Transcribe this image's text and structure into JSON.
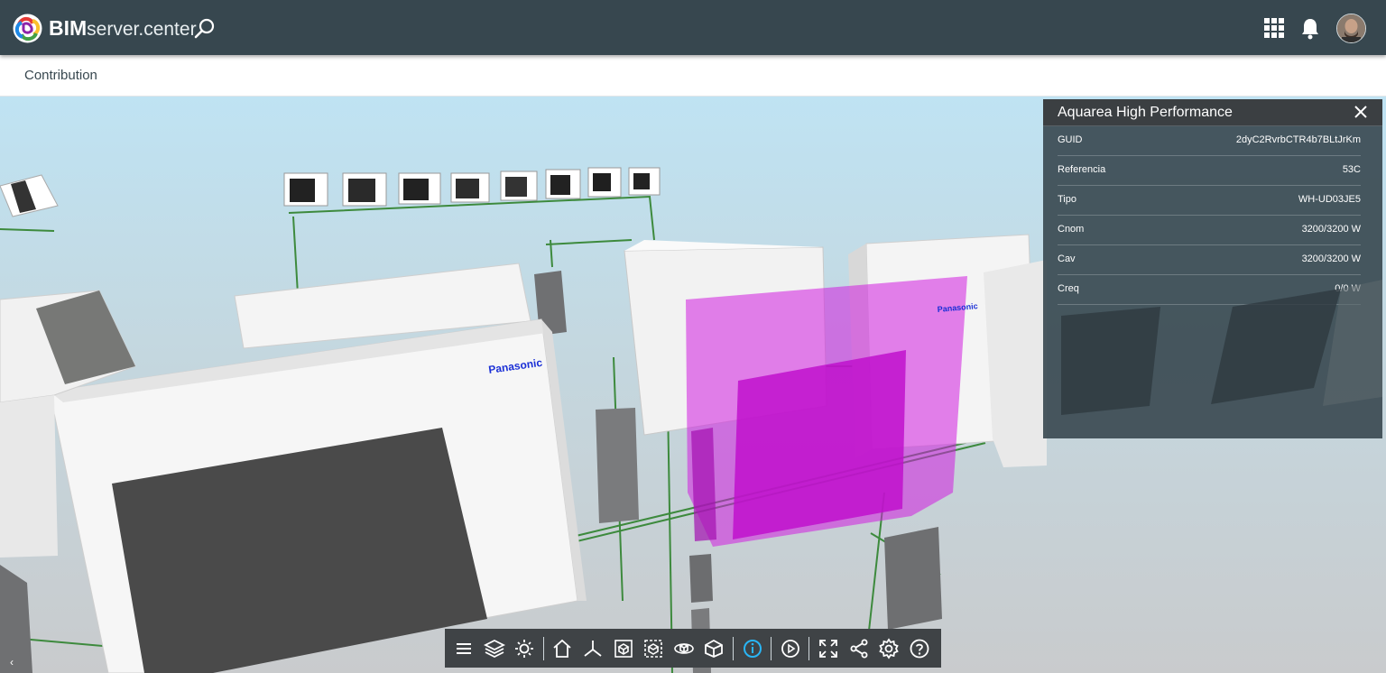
{
  "app": {
    "brand_bold": "BIM",
    "brand_light": "server.center"
  },
  "header": {
    "icons": [
      "search-icon",
      "apps-grid-icon",
      "bell-icon",
      "user-avatar"
    ]
  },
  "subnav": {
    "breadcrumb": "Contribution"
  },
  "model": {
    "brand_labels": [
      "Panasonic",
      "Panasonic",
      "Panasonic"
    ],
    "selection_color": "#d21ee0"
  },
  "properties_panel": {
    "title": "Aquarea High Performance",
    "rows": [
      {
        "key": "GUID",
        "value": "2dyC2RvrbCTR4b7BLtJrKm"
      },
      {
        "key": "Referencia",
        "value": "53C"
      },
      {
        "key": "Tipo",
        "value": "WH-UD03JE5"
      },
      {
        "key": "Cnom",
        "value": "3200/3200 W"
      },
      {
        "key": "Cav",
        "value": "3200/3200 W"
      },
      {
        "key": "Creq",
        "value": "0/0 W"
      }
    ]
  },
  "toolbar": {
    "tools": [
      "menu",
      "layers",
      "lighting",
      "home",
      "axes",
      "section-box",
      "selection-box",
      "orbit",
      "object-view",
      "info",
      "play",
      "fullscreen",
      "share",
      "settings",
      "help"
    ],
    "active_tool": "info"
  },
  "colors": {
    "header_bg": "#37474f",
    "accent": "#29b6f6",
    "panel_bg": "#37474f"
  }
}
